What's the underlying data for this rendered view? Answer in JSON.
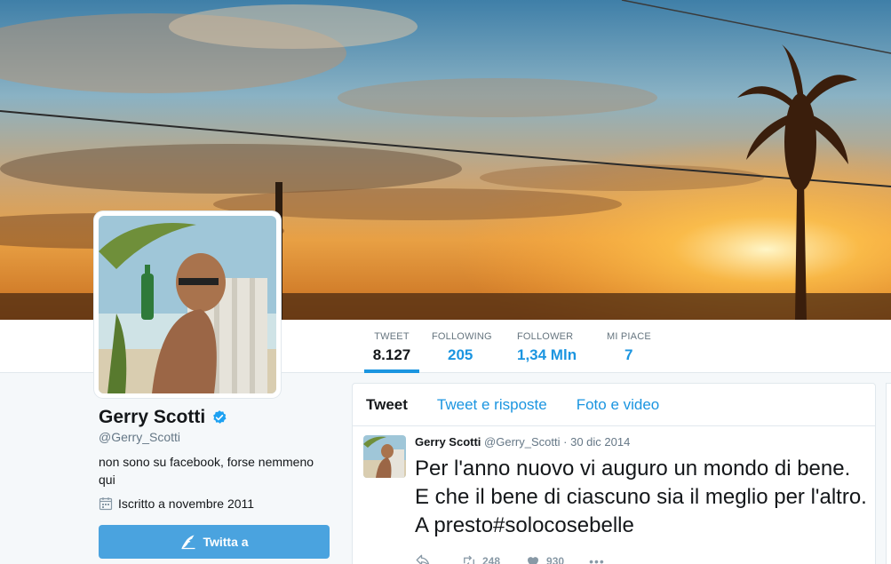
{
  "profile": {
    "name": "Gerry Scotti",
    "handle": "@Gerry_Scotti",
    "bio": "non sono su facebook, forse nemmeno qui",
    "joined": "Iscritto a novembre 2011",
    "tweet_to_label": "Twitta a"
  },
  "stats": [
    {
      "label": "TWEET",
      "value": "8.127"
    },
    {
      "label": "FOLLOWING",
      "value": "205"
    },
    {
      "label": "FOLLOWER",
      "value": "1,34 Mln"
    },
    {
      "label": "MI PIACE",
      "value": "7"
    }
  ],
  "tabs": [
    {
      "label": "Tweet"
    },
    {
      "label": "Tweet e risposte"
    },
    {
      "label": "Foto e video"
    }
  ],
  "tweet": {
    "author": "Gerry Scotti",
    "handle": "@Gerry_Scotti",
    "separator": "·",
    "date": "30 dic 2014",
    "text": "Per l'anno nuovo vi auguro un mondo di bene. E che il bene di ciascuno sia il meglio per l'altro. A presto#solocosebelle",
    "retweets": "248",
    "likes": "930",
    "more": "•••"
  },
  "colors": {
    "accent": "#1b95e0",
    "button": "#4aa3df",
    "verified": "#1da1f2"
  },
  "icons": [
    "verified-badge-icon",
    "calendar-icon",
    "quill-icon",
    "reply-icon",
    "retweet-icon",
    "heart-icon",
    "more-icon"
  ]
}
